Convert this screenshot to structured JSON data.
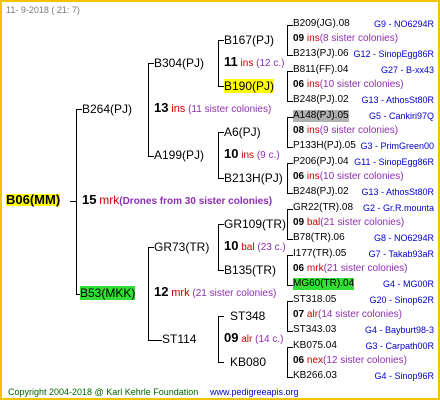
{
  "header": {
    "date": "11-  9-2018 ( 21:  7)"
  },
  "root": {
    "label": "B06(MM)",
    "count": "15",
    "mark": "mrk",
    "note": "(Drones from 30 sister colonies)"
  },
  "gen1": [
    {
      "label": "B264(PJ)",
      "count": "13",
      "mark": "ins",
      "note": "(11 sister colonies)"
    },
    {
      "label": "B53(MKK)",
      "count": "12",
      "mark": "mrk",
      "note": "(21 sister colonies)"
    }
  ],
  "gen2": [
    {
      "label": "B304(PJ)"
    },
    {
      "label": "A199(PJ)"
    },
    {
      "label": "GR73(TR)"
    },
    {
      "label": "ST114"
    }
  ],
  "gen3": [
    {
      "label": "B167(PJ)",
      "count": "11",
      "mark": "ins",
      "note": "(12 c.)"
    },
    {
      "label": "B190(PJ)"
    },
    {
      "label": "A6(PJ)",
      "count": "10",
      "mark": "ins",
      "note": "(9 c.)"
    },
    {
      "label": "B213H(PJ)"
    },
    {
      "label": "GR109(TR)",
      "count": "10",
      "mark": "bal",
      "note": "(23 c.)"
    },
    {
      "label": "B135(TR)"
    },
    {
      "label": "ST348",
      "count": "09",
      "mark": "alr",
      "note": "(14 c.)"
    },
    {
      "label": "KB080"
    }
  ],
  "gen4": [
    {
      "label": "B209(JG).08",
      "info": "G9 - NO6294R"
    },
    {
      "count": "09",
      "mark": "ins",
      "note": "(8 sister colonies)"
    },
    {
      "label": "B213(PJ).06",
      "info": "G12 - SinopEgg86R"
    },
    {
      "label": "B811(FF).04",
      "info": "G27 - B-xx43"
    },
    {
      "count": "06",
      "mark": "ins",
      "note": "(10 sister colonies)"
    },
    {
      "label": "B248(PJ).02",
      "info": "G13 - AthosSt80R"
    },
    {
      "label": "A148(PJ).05",
      "info": "G5 - Cankiri97Q"
    },
    {
      "count": "08",
      "mark": "ins",
      "note": "(9 sister colonies)"
    },
    {
      "label": "P133H(PJ).05",
      "info": "G3 - PrimGreen00"
    },
    {
      "label": "P206(PJ).04",
      "info": "G11 - SinopEgg86R"
    },
    {
      "count": "06",
      "mark": "ins",
      "note": "(10 sister colonies)"
    },
    {
      "label": "B248(PJ).02",
      "info": "G13 - AthosSt80R"
    },
    {
      "label": "GR22(TR).08",
      "info": "G2 - Gr.R.mounta"
    },
    {
      "count": "09",
      "mark": "bal",
      "note": "(21 sister colonies)"
    },
    {
      "label": "B78(TR).06",
      "info": "G8 - NO6294R"
    },
    {
      "label": "I177(TR).05",
      "info": "G7 - Takab93aR"
    },
    {
      "count": "06",
      "mark": "mrk",
      "note": "(21 sister colonies)"
    },
    {
      "label": "MG60(TR).04",
      "info": "G4 - MG00R"
    },
    {
      "label": "ST318.05",
      "info": "G20 - Sinop62R"
    },
    {
      "count": "07",
      "mark": "alr",
      "note": "(14 sister colonies)"
    },
    {
      "label": "ST343.03",
      "info": "G4 - Bayburt98-3"
    },
    {
      "label": "KB075.04",
      "info": "G3 - Carpath00R"
    },
    {
      "count": "06",
      "mark": "nex",
      "note": "(12 sister colonies)"
    },
    {
      "label": "KB266.03",
      "info": "G4 - Sinop96R"
    }
  ],
  "footer": {
    "copyright": "Copyright 2004-2018 @ Karl Kehrle Foundation",
    "url": "www.pedigreeapis.org"
  }
}
